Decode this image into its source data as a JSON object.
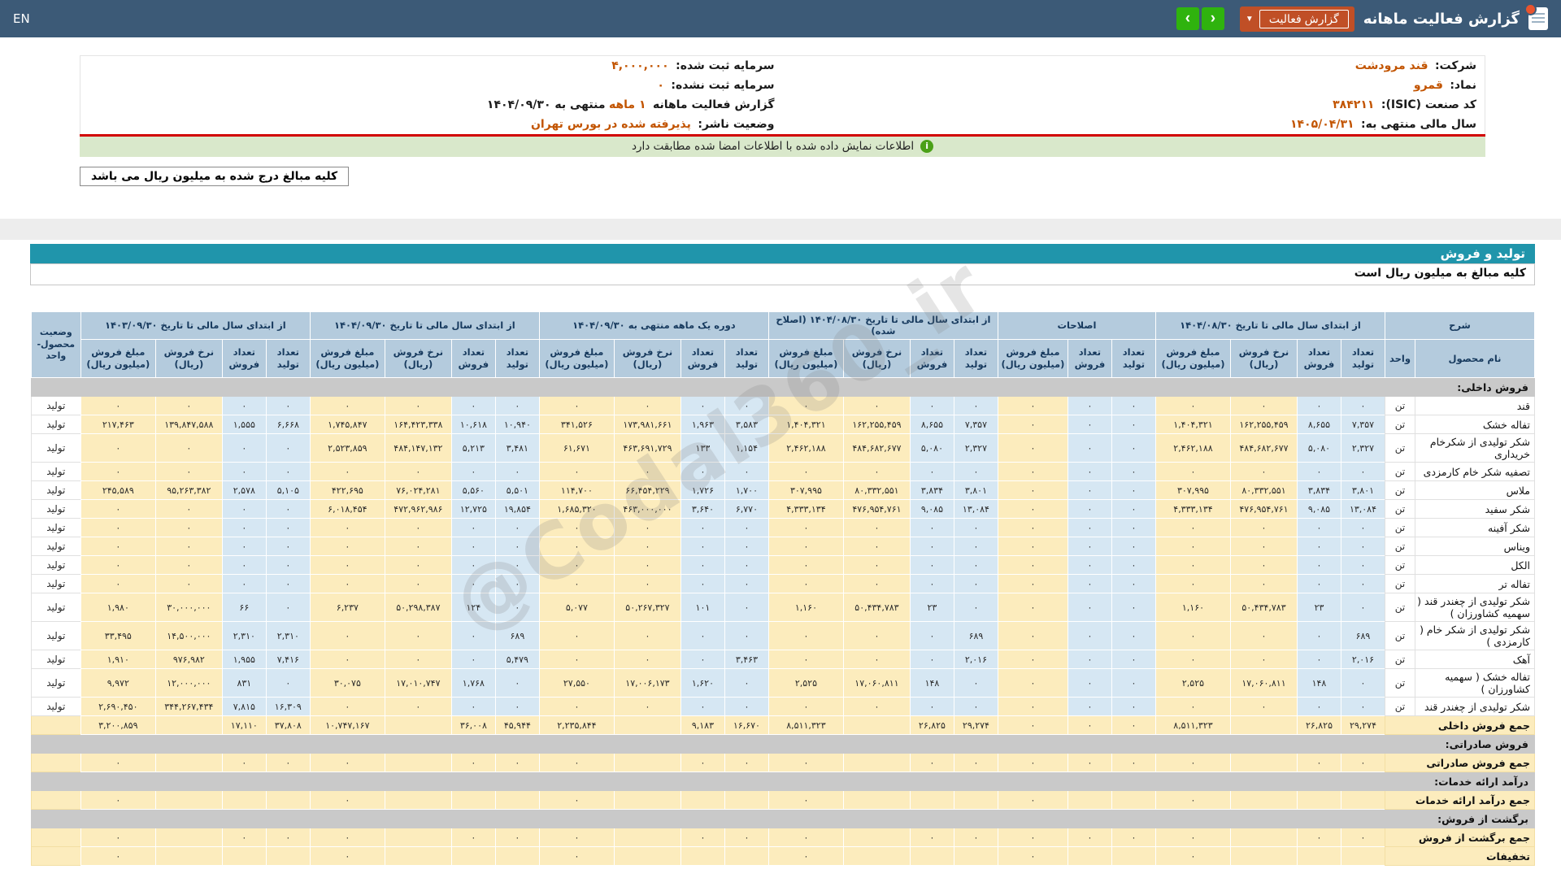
{
  "navbar": {
    "en_label": "EN",
    "title": "گزارش فعالیت ماهانه",
    "report_type_button": "گزارش فعالیت",
    "nav_arrows": {
      "right": "›",
      "left": "‹"
    },
    "colors": {
      "navbar_bg": "#3c5a77",
      "button_orange": "#c04f26",
      "arrow_green": "#2fb30e",
      "section_teal": "#2095ab",
      "link_orange": "#c25400"
    }
  },
  "company_info": {
    "right": [
      {
        "label": "شرکت:",
        "value": "قند مرودشت"
      },
      {
        "label": "نماد:",
        "value": "قمرو"
      },
      {
        "label": "کد صنعت (ISIC):",
        "value": "۳۸۴۲۱۱"
      },
      {
        "label": "سال مالی منتهی به:",
        "value": "۱۴۰۵/۰۴/۳۱"
      }
    ],
    "left": [
      {
        "label": "سرمایه ثبت شده:",
        "value": "۴,۰۰۰,۰۰۰"
      },
      {
        "label": "سرمایه ثبت نشده:",
        "value": "۰"
      },
      {
        "label": "گزارش فعالیت ماهانه",
        "value": "۱ ماهه",
        "suffix": "منتهی به ۱۴۰۴/۰۹/۳۰"
      },
      {
        "label": "وضعیت ناشر:",
        "value": "پذیرفته شده در بورس تهران"
      }
    ],
    "signature_notice": "اطلاعات نمایش داده شده با اطلاعات امضا شده مطابقت دارد",
    "amounts_note": "کلیه مبالغ درج شده به میلیون ریال می باشد"
  },
  "section": {
    "title": "تولید و فروش",
    "subtitle": "کلیه مبالغ به میلیون ریال است"
  },
  "watermark": "@Codal360_ir",
  "table": {
    "groups": [
      {
        "label": "شرح",
        "sub": [
          "نام محصول",
          "واحد"
        ]
      },
      {
        "label": "از ابتدای سال مالی تا تاریخ ۱۴۰۴/۰۸/۳۰",
        "cols": 4
      },
      {
        "label": "اصلاحات",
        "cols": 3
      },
      {
        "label": "از ابتدای سال مالی تا تاریخ ۱۴۰۴/۰۸/۳۰ (اصلاح شده)",
        "cols": 4
      },
      {
        "label": "دوره یک ماهه منتهی به ۱۴۰۴/۰۹/۳۰",
        "cols": 4
      },
      {
        "label": "از ابتدای سال مالی تا تاریخ ۱۴۰۴/۰۹/۳۰",
        "cols": 4
      },
      {
        "label": "از ابتدای سال مالی تا تاریخ ۱۴۰۳/۰۹/۳۰",
        "cols": 4
      }
    ],
    "status_header": "وضعیت\nمحصول-واحد",
    "sub4": [
      "تعداد\nتولید",
      "تعداد\nفروش",
      "نرخ فروش\n(ریال)",
      "مبلغ فروش\n(میلیون ریال)"
    ],
    "sub3": [
      "تعداد\nتولید",
      "تعداد\nفروش",
      "مبلغ فروش\n(میلیون ریال)"
    ],
    "rows": [
      {
        "t": "section",
        "name": "فروش داخلی:"
      },
      {
        "t": "data",
        "name": "قند",
        "unit": "تن",
        "status": "تولید",
        "c": [
          "۰",
          "۰",
          "۰",
          "۰",
          "۰",
          "۰",
          "۰",
          "۰",
          "۰",
          "۰",
          "۰",
          "۰",
          "۰",
          "۰",
          "۰",
          "۰",
          "۰",
          "۰",
          "۰",
          "۰",
          "۰",
          "۰",
          "۰"
        ]
      },
      {
        "t": "data",
        "name": "تفاله خشک",
        "unit": "تن",
        "status": "تولید",
        "c": [
          "۷,۳۵۷",
          "۸,۶۵۵",
          "۱۶۲,۲۵۵,۴۵۹",
          "۱,۴۰۴,۳۲۱",
          "۰",
          "۰",
          "۰",
          "۷,۳۵۷",
          "۸,۶۵۵",
          "۱۶۲,۲۵۵,۴۵۹",
          "۱,۴۰۴,۳۲۱",
          "۳,۵۸۳",
          "۱,۹۶۳",
          "۱۷۳,۹۸۱,۶۶۱",
          "۳۴۱,۵۲۶",
          "۱۰,۹۴۰",
          "۱۰,۶۱۸",
          "۱۶۴,۴۲۳,۳۳۸",
          "۱,۷۴۵,۸۴۷",
          "۶,۶۶۸",
          "۱,۵۵۵",
          "۱۳۹,۸۴۷,۵۸۸",
          "۲۱۷,۴۶۳"
        ]
      },
      {
        "t": "data",
        "name": "شکر تولیدی از شکرخام خریداری",
        "unit": "تن",
        "status": "تولید",
        "c": [
          "۲,۳۲۷",
          "۵,۰۸۰",
          "۴۸۴,۶۸۲,۶۷۷",
          "۲,۴۶۲,۱۸۸",
          "۰",
          "۰",
          "۰",
          "۲,۳۲۷",
          "۵,۰۸۰",
          "۴۸۴,۶۸۲,۶۷۷",
          "۲,۴۶۲,۱۸۸",
          "۱,۱۵۴",
          "۱۳۳",
          "۴۶۳,۶۹۱,۷۲۹",
          "۶۱,۶۷۱",
          "۳,۴۸۱",
          "۵,۲۱۳",
          "۴۸۴,۱۴۷,۱۳۲",
          "۲,۵۲۳,۸۵۹",
          "۰",
          "۰",
          "۰",
          "۰"
        ]
      },
      {
        "t": "data",
        "name": "تصفیه شکر خام کارمزدی",
        "unit": "تن",
        "status": "تولید",
        "c": [
          "۰",
          "۰",
          "۰",
          "۰",
          "۰",
          "۰",
          "۰",
          "۰",
          "۰",
          "۰",
          "۰",
          "۰",
          "۰",
          "۰",
          "۰",
          "۰",
          "۰",
          "۰",
          "۰",
          "۰",
          "۰",
          "۰",
          "۰"
        ]
      },
      {
        "t": "data",
        "name": "ملاس",
        "unit": "تن",
        "status": "تولید",
        "c": [
          "۳,۸۰۱",
          "۳,۸۳۴",
          "۸۰,۳۳۲,۵۵۱",
          "۳۰۷,۹۹۵",
          "۰",
          "۰",
          "۰",
          "۳,۸۰۱",
          "۳,۸۳۴",
          "۸۰,۳۳۲,۵۵۱",
          "۳۰۷,۹۹۵",
          "۱,۷۰۰",
          "۱,۷۲۶",
          "۶۶,۴۵۴,۲۲۹",
          "۱۱۴,۷۰۰",
          "۵,۵۰۱",
          "۵,۵۶۰",
          "۷۶,۰۲۴,۲۸۱",
          "۴۲۲,۶۹۵",
          "۵,۱۰۵",
          "۲,۵۷۸",
          "۹۵,۲۶۳,۳۸۲",
          "۲۴۵,۵۸۹"
        ]
      },
      {
        "t": "data",
        "name": "شکر سفید",
        "unit": "تن",
        "status": "تولید",
        "c": [
          "۱۳,۰۸۴",
          "۹,۰۸۵",
          "۴۷۶,۹۵۴,۷۶۱",
          "۴,۳۳۳,۱۳۴",
          "۰",
          "۰",
          "۰",
          "۱۳,۰۸۴",
          "۹,۰۸۵",
          "۴۷۶,۹۵۴,۷۶۱",
          "۴,۳۳۳,۱۳۴",
          "۶,۷۷۰",
          "۳,۶۴۰",
          "۴۶۳,۰۰۰,۰۰۰",
          "۱,۶۸۵,۳۲۰",
          "۱۹,۸۵۴",
          "۱۲,۷۲۵",
          "۴۷۲,۹۶۲,۹۸۶",
          "۶,۰۱۸,۴۵۴",
          "۰",
          "۰",
          "۰",
          "۰"
        ]
      },
      {
        "t": "data",
        "name": "شکر آفینه",
        "unit": "تن",
        "status": "تولید",
        "c": [
          "۰",
          "۰",
          "۰",
          "۰",
          "۰",
          "۰",
          "۰",
          "۰",
          "۰",
          "۰",
          "۰",
          "۰",
          "۰",
          "۰",
          "۰",
          "۰",
          "۰",
          "۰",
          "۰",
          "۰",
          "۰",
          "۰",
          "۰"
        ]
      },
      {
        "t": "data",
        "name": "ویناس",
        "unit": "تن",
        "status": "تولید",
        "c": [
          "۰",
          "۰",
          "۰",
          "۰",
          "۰",
          "۰",
          "۰",
          "۰",
          "۰",
          "۰",
          "۰",
          "۰",
          "۰",
          "۰",
          "۰",
          "۰",
          "۰",
          "۰",
          "۰",
          "۰",
          "۰",
          "۰",
          "۰"
        ]
      },
      {
        "t": "data",
        "name": "الکل",
        "unit": "تن",
        "status": "تولید",
        "c": [
          "۰",
          "۰",
          "۰",
          "۰",
          "۰",
          "۰",
          "۰",
          "۰",
          "۰",
          "۰",
          "۰",
          "۰",
          "۰",
          "۰",
          "۰",
          "۰",
          "۰",
          "۰",
          "۰",
          "۰",
          "۰",
          "۰",
          "۰"
        ]
      },
      {
        "t": "data",
        "name": "تفاله تر",
        "unit": "تن",
        "status": "تولید",
        "c": [
          "۰",
          "۰",
          "۰",
          "۰",
          "۰",
          "۰",
          "۰",
          "۰",
          "۰",
          "۰",
          "۰",
          "۰",
          "۰",
          "۰",
          "۰",
          "۰",
          "۰",
          "۰",
          "۰",
          "۰",
          "۰",
          "۰",
          "۰"
        ]
      },
      {
        "t": "data",
        "name": "شکر تولیدی از چغندر قند ( سهمیه کشاورزان )",
        "unit": "تن",
        "status": "تولید",
        "c": [
          "۰",
          "۲۳",
          "۵۰,۴۳۴,۷۸۳",
          "۱,۱۶۰",
          "۰",
          "۰",
          "۰",
          "۰",
          "۲۳",
          "۵۰,۴۳۴,۷۸۳",
          "۱,۱۶۰",
          "۰",
          "۱۰۱",
          "۵۰,۲۶۷,۳۲۷",
          "۵,۰۷۷",
          "۰",
          "۱۲۴",
          "۵۰,۲۹۸,۳۸۷",
          "۶,۲۳۷",
          "۰",
          "۶۶",
          "۳۰,۰۰۰,۰۰۰",
          "۱,۹۸۰"
        ]
      },
      {
        "t": "data",
        "name": "شکر تولیدی از شکر خام ( کارمزدی )",
        "unit": "تن",
        "status": "تولید",
        "c": [
          "۶۸۹",
          "۰",
          "۰",
          "۰",
          "۰",
          "۰",
          "۰",
          "۶۸۹",
          "۰",
          "۰",
          "۰",
          "۰",
          "۰",
          "۰",
          "۰",
          "۶۸۹",
          "۰",
          "۰",
          "۰",
          "۲,۳۱۰",
          "۲,۳۱۰",
          "۱۴,۵۰۰,۰۰۰",
          "۳۳,۴۹۵"
        ]
      },
      {
        "t": "data",
        "name": "آهک",
        "unit": "تن",
        "status": "تولید",
        "c": [
          "۲,۰۱۶",
          "۰",
          "۰",
          "۰",
          "۰",
          "۰",
          "۰",
          "۲,۰۱۶",
          "۰",
          "۰",
          "۰",
          "۳,۴۶۳",
          "۰",
          "۰",
          "۰",
          "۵,۴۷۹",
          "۰",
          "۰",
          "۰",
          "۷,۴۱۶",
          "۱,۹۵۵",
          "۹۷۶,۹۸۲",
          "۱,۹۱۰"
        ]
      },
      {
        "t": "data",
        "name": "تفاله خشک ( سهمیه کشاورزان )",
        "unit": "تن",
        "status": "تولید",
        "c": [
          "۰",
          "۱۴۸",
          "۱۷,۰۶۰,۸۱۱",
          "۲,۵۲۵",
          "۰",
          "۰",
          "۰",
          "۰",
          "۱۴۸",
          "۱۷,۰۶۰,۸۱۱",
          "۲,۵۲۵",
          "۰",
          "۱,۶۲۰",
          "۱۷,۰۰۶,۱۷۳",
          "۲۷,۵۵۰",
          "۰",
          "۱,۷۶۸",
          "۱۷,۰۱۰,۷۴۷",
          "۳۰,۰۷۵",
          "۰",
          "۸۳۱",
          "۱۲,۰۰۰,۰۰۰",
          "۹,۹۷۲"
        ]
      },
      {
        "t": "data",
        "name": "شکر تولیدی از چغندر قند",
        "unit": "تن",
        "status": "تولید",
        "c": [
          "۰",
          "۰",
          "۰",
          "۰",
          "۰",
          "۰",
          "۰",
          "۰",
          "۰",
          "۰",
          "۰",
          "۰",
          "۰",
          "۰",
          "۰",
          "۰",
          "۰",
          "۰",
          "۰",
          "۱۶,۳۰۹",
          "۷,۸۱۵",
          "۳۴۴,۲۶۷,۴۳۴",
          "۲,۶۹۰,۴۵۰"
        ]
      },
      {
        "t": "total",
        "name": "جمع فروش داخلی",
        "c": [
          "۲۹,۲۷۴",
          "۲۶,۸۲۵",
          "",
          "۸,۵۱۱,۳۲۳",
          "۰",
          "۰",
          "۰",
          "۲۹,۲۷۴",
          "۲۶,۸۲۵",
          "",
          "۸,۵۱۱,۳۲۳",
          "۱۶,۶۷۰",
          "۹,۱۸۳",
          "",
          "۲,۲۳۵,۸۴۴",
          "۴۵,۹۴۴",
          "۳۶,۰۰۸",
          "",
          "۱۰,۷۴۷,۱۶۷",
          "۳۷,۸۰۸",
          "۱۷,۱۱۰",
          "",
          "۳,۲۰۰,۸۵۹"
        ]
      },
      {
        "t": "section",
        "name": "فروش صادراتی:"
      },
      {
        "t": "total",
        "name": "جمع فروش صادراتی",
        "c": [
          "۰",
          "۰",
          "",
          "۰",
          "۰",
          "۰",
          "۰",
          "۰",
          "۰",
          "",
          "۰",
          "۰",
          "۰",
          "",
          "۰",
          "۰",
          "۰",
          "",
          "۰",
          "۰",
          "۰",
          "",
          "۰"
        ]
      },
      {
        "t": "section",
        "name": "درآمد ارائه خدمات:"
      },
      {
        "t": "total",
        "name": "جمع درآمد ارائه خدمات",
        "c": [
          "",
          "",
          "",
          "۰",
          "",
          "",
          "۰",
          "",
          "",
          "",
          "۰",
          "",
          "",
          "",
          "۰",
          "",
          "",
          "",
          "۰",
          "",
          "",
          "",
          "۰"
        ]
      },
      {
        "t": "section",
        "name": "برگشت از فروش:"
      },
      {
        "t": "total",
        "name": "جمع برگشت از فروش",
        "c": [
          "۰",
          "۰",
          "",
          "۰",
          "۰",
          "۰",
          "۰",
          "۰",
          "۰",
          "",
          "۰",
          "۰",
          "۰",
          "",
          "۰",
          "۰",
          "۰",
          "",
          "۰",
          "۰",
          "۰",
          "",
          "۰"
        ]
      },
      {
        "t": "total",
        "name": "تخفیفات",
        "c": [
          "",
          "",
          "",
          "۰",
          "",
          "",
          "۰",
          "",
          "",
          "",
          "۰",
          "",
          "",
          "",
          "۰",
          "",
          "",
          "",
          "۰",
          "",
          "",
          "",
          "۰"
        ]
      }
    ]
  }
}
